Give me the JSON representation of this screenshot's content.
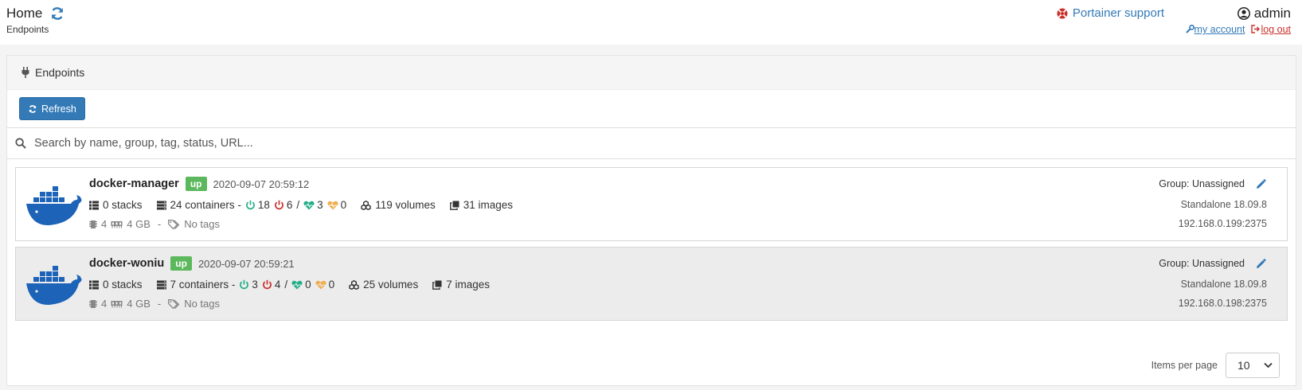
{
  "header": {
    "title": "Home",
    "breadcrumb": "Endpoints",
    "support_label": "Portainer support",
    "username": "admin",
    "my_account": "my account",
    "log_out": "log out"
  },
  "widget": {
    "title": "Endpoints",
    "refresh_label": "Refresh",
    "search_placeholder": "Search by name, group, tag, status, URL..."
  },
  "endpoints": [
    {
      "name": "docker-manager",
      "status": "up",
      "timestamp": "2020-09-07 20:59:12",
      "stacks": "0 stacks",
      "containers": "24 containers -",
      "running": "18",
      "stopped": "6",
      "separator": "/",
      "healthy": "3",
      "unhealthy": "0",
      "volumes": "119 volumes",
      "images": "31 images",
      "cpu": "4",
      "memory": "4 GB",
      "dash": "-",
      "tags": "No tags",
      "group": "Group: Unassigned",
      "docker": "Standalone 18.09.8",
      "url": "192.168.0.199:2375"
    },
    {
      "name": "docker-woniu",
      "status": "up",
      "timestamp": "2020-09-07 20:59:21",
      "stacks": "0 stacks",
      "containers": "7 containers -",
      "running": "3",
      "stopped": "4",
      "separator": "/",
      "healthy": "0",
      "unhealthy": "0",
      "volumes": "25 volumes",
      "images": "7 images",
      "cpu": "4",
      "memory": "4 GB",
      "dash": "-",
      "tags": "No tags",
      "group": "Group: Unassigned",
      "docker": "Standalone 18.09.8",
      "url": "192.168.0.198:2375"
    }
  ],
  "pagination": {
    "items_per_page_label": "Items per page",
    "items_per_page_value": "10"
  },
  "colors": {
    "primary": "#337ab7",
    "success": "#5cb85c",
    "danger": "#c9302c",
    "running": "#23ae89",
    "warning": "#f0ad4e"
  }
}
